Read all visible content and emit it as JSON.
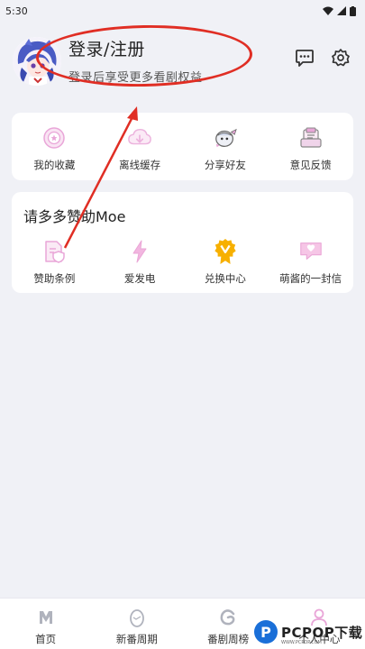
{
  "status_bar": {
    "time": "5:30"
  },
  "header": {
    "login_title": "登录/注册",
    "login_subtitle": "登录后享受更多看剧权益"
  },
  "quick_actions": [
    {
      "label": "我的收藏",
      "icon": "favorites-icon"
    },
    {
      "label": "离线缓存",
      "icon": "cloud-download-icon"
    },
    {
      "label": "分享好友",
      "icon": "share-icon"
    },
    {
      "label": "意见反馈",
      "icon": "feedback-icon"
    }
  ],
  "sponsor": {
    "title": "请多多赞助Moe",
    "items": [
      {
        "label": "赞助条例",
        "icon": "document-shield-icon"
      },
      {
        "label": "爱发电",
        "icon": "lightning-icon"
      },
      {
        "label": "兑换中心",
        "icon": "badge-icon"
      },
      {
        "label": "萌酱的一封信",
        "icon": "letter-icon"
      }
    ]
  },
  "bottom_nav": [
    {
      "label": "首页",
      "icon": "home-icon"
    },
    {
      "label": "新番周期",
      "icon": "egg-icon"
    },
    {
      "label": "番剧周榜",
      "icon": "ranking-icon"
    },
    {
      "label": "个人中心",
      "icon": "person-icon"
    }
  ],
  "watermark": {
    "text": "PCPOP下载",
    "sub": "WWW.PCPOP.COM"
  },
  "colors": {
    "accent_pink": "#e9a6d8",
    "accent_orange": "#f7b000",
    "annotation_red": "#e02e24"
  }
}
